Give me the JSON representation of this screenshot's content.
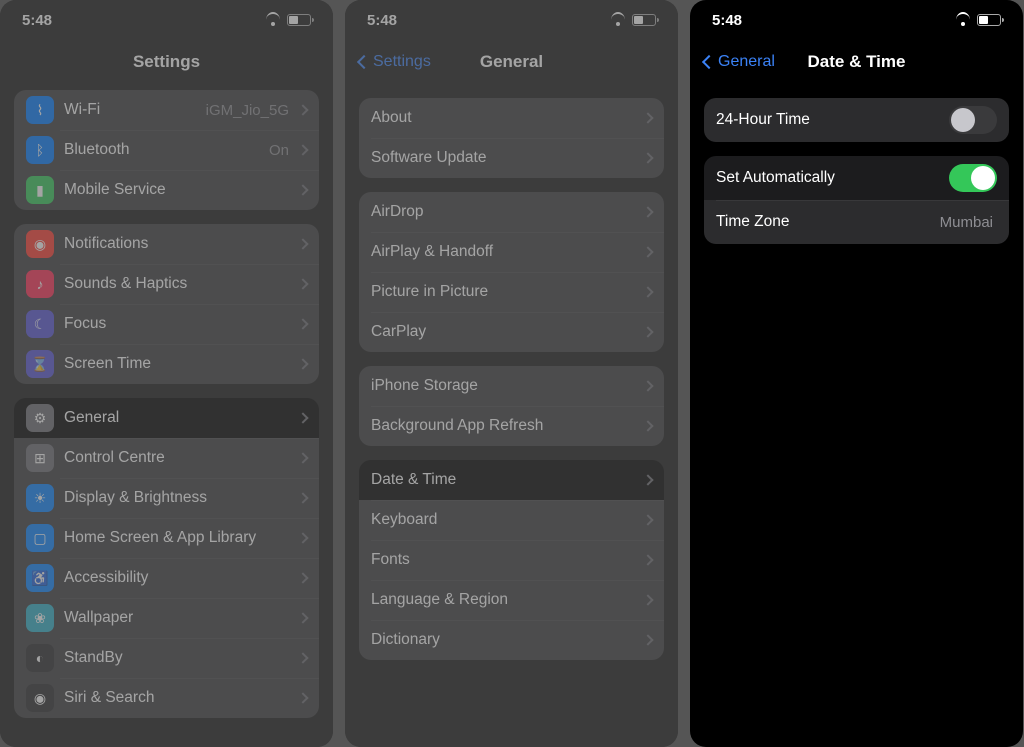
{
  "status": {
    "time": "5:48"
  },
  "screen1": {
    "title": "Settings",
    "rows": {
      "wifi": {
        "label": "Wi-Fi",
        "value": "iGM_Jio_5G"
      },
      "bluetooth": {
        "label": "Bluetooth",
        "value": "On"
      },
      "mobile": {
        "label": "Mobile Service"
      },
      "notif": {
        "label": "Notifications"
      },
      "sounds": {
        "label": "Sounds & Haptics"
      },
      "focus": {
        "label": "Focus"
      },
      "screentime": {
        "label": "Screen Time"
      },
      "general": {
        "label": "General"
      },
      "control": {
        "label": "Control Centre"
      },
      "display": {
        "label": "Display & Brightness"
      },
      "home": {
        "label": "Home Screen & App Library"
      },
      "access": {
        "label": "Accessibility"
      },
      "wallpaper": {
        "label": "Wallpaper"
      },
      "standby": {
        "label": "StandBy"
      },
      "siri": {
        "label": "Siri & Search"
      }
    }
  },
  "screen2": {
    "back": "Settings",
    "title": "General",
    "rows": {
      "about": {
        "label": "About"
      },
      "swupdate": {
        "label": "Software Update"
      },
      "airdrop": {
        "label": "AirDrop"
      },
      "airplay": {
        "label": "AirPlay & Handoff"
      },
      "pip": {
        "label": "Picture in Picture"
      },
      "carplay": {
        "label": "CarPlay"
      },
      "storage": {
        "label": "iPhone Storage"
      },
      "bgrefresh": {
        "label": "Background App Refresh"
      },
      "datetime": {
        "label": "Date & Time"
      },
      "keyboard": {
        "label": "Keyboard"
      },
      "fonts": {
        "label": "Fonts"
      },
      "region": {
        "label": "Language & Region"
      },
      "dict": {
        "label": "Dictionary"
      }
    }
  },
  "screen3": {
    "back": "General",
    "title": "Date & Time",
    "rows": {
      "hour24": {
        "label": "24-Hour Time"
      },
      "autoset": {
        "label": "Set Automatically"
      },
      "timezone": {
        "label": "Time Zone",
        "value": "Mumbai"
      }
    }
  }
}
